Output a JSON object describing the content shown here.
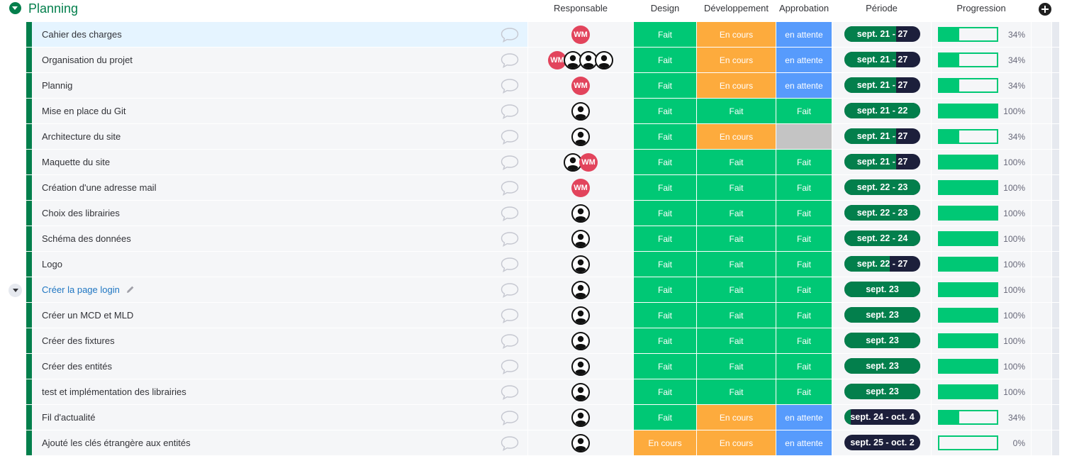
{
  "group": {
    "title": "Planning",
    "color": "#037f4c"
  },
  "columns": {
    "owner": "Responsable",
    "design": "Design",
    "dev": "Développement",
    "approval": "Approbation",
    "period": "Période",
    "progress": "Progression"
  },
  "colors": {
    "done": "#00c875",
    "working": "#fdab3d",
    "waiting": "#579bfc",
    "empty": "#c4c4c4",
    "timeline_fill": "#037f4c",
    "timeline_rest": "#1c1f3b",
    "owner_initials_bg": "#e2445c"
  },
  "icons": {
    "comment": "speech-bubble-icon",
    "person": "user-avatar-icon",
    "expand": "chevron-down-icon",
    "add_column": "plus-circle-icon",
    "edit": "pencil-icon"
  },
  "rows": [
    {
      "name": "Cahier des charges",
      "selected": true,
      "owners": [
        "WM"
      ],
      "design": "Fait",
      "dev": "En cours",
      "approval": "en attente",
      "period": "sept. 21 - 27",
      "period_elapsed": 0.68,
      "progress": 34,
      "progress_label": "34%"
    },
    {
      "name": "Organisation du projet",
      "owners": [
        "WM",
        "person",
        "person",
        "person"
      ],
      "design": "Fait",
      "dev": "En cours",
      "approval": "en attente",
      "period": "sept. 21 - 27",
      "period_elapsed": 0.68,
      "progress": 34,
      "progress_label": "34%"
    },
    {
      "name": "Plannig",
      "owners": [
        "WM"
      ],
      "design": "Fait",
      "dev": "En cours",
      "approval": "en attente",
      "period": "sept. 21 - 27",
      "period_elapsed": 0.68,
      "progress": 34,
      "progress_label": "34%"
    },
    {
      "name": "Mise en place du Git",
      "owners": [
        "person"
      ],
      "design": "Fait",
      "dev": "Fait",
      "approval": "Fait",
      "period": "sept. 21 - 22",
      "period_elapsed": 1.0,
      "progress": 100,
      "progress_label": "100%"
    },
    {
      "name": "Architecture du site",
      "owners": [
        "person"
      ],
      "design": "Fait",
      "dev": "En cours",
      "approval": "",
      "period": "sept. 21 - 27",
      "period_elapsed": 0.68,
      "progress": 34,
      "progress_label": "34%"
    },
    {
      "name": "Maquette du site",
      "owners": [
        "person",
        "WM"
      ],
      "design": "Fait",
      "dev": "Fait",
      "approval": "Fait",
      "period": "sept. 21 - 27",
      "period_elapsed": 0.68,
      "progress": 100,
      "progress_label": "100%"
    },
    {
      "name": "Création d'une adresse mail",
      "owners": [
        "WM"
      ],
      "design": "Fait",
      "dev": "Fait",
      "approval": "Fait",
      "period": "sept. 22 - 23",
      "period_elapsed": 1.0,
      "progress": 100,
      "progress_label": "100%"
    },
    {
      "name": "Choix des librairies",
      "owners": [
        "person"
      ],
      "design": "Fait",
      "dev": "Fait",
      "approval": "Fait",
      "period": "sept. 22 - 23",
      "period_elapsed": 1.0,
      "progress": 100,
      "progress_label": "100%"
    },
    {
      "name": "Schéma des données",
      "owners": [
        "person"
      ],
      "design": "Fait",
      "dev": "Fait",
      "approval": "Fait",
      "period": "sept. 22 - 24",
      "period_elapsed": 1.0,
      "progress": 100,
      "progress_label": "100%"
    },
    {
      "name": "Logo",
      "owners": [
        "person"
      ],
      "design": "Fait",
      "dev": "Fait",
      "approval": "Fait",
      "period": "sept. 22 - 27",
      "period_elapsed": 0.6,
      "progress": 100,
      "progress_label": "100%"
    },
    {
      "name": "Créer la page login",
      "linked": true,
      "expandable": true,
      "owners": [
        "person"
      ],
      "design": "Fait",
      "dev": "Fait",
      "approval": "Fait",
      "period": "sept. 23",
      "period_elapsed": 1.0,
      "progress": 100,
      "progress_label": "100%"
    },
    {
      "name": "Créer un MCD et MLD",
      "owners": [
        "person"
      ],
      "design": "Fait",
      "dev": "Fait",
      "approval": "Fait",
      "period": "sept. 23",
      "period_elapsed": 1.0,
      "progress": 100,
      "progress_label": "100%"
    },
    {
      "name": "Créer des fixtures",
      "owners": [
        "person"
      ],
      "design": "Fait",
      "dev": "Fait",
      "approval": "Fait",
      "period": "sept. 23",
      "period_elapsed": 1.0,
      "progress": 100,
      "progress_label": "100%"
    },
    {
      "name": "Créer des entités",
      "owners": [
        "person"
      ],
      "design": "Fait",
      "dev": "Fait",
      "approval": "Fait",
      "period": "sept. 23",
      "period_elapsed": 1.0,
      "progress": 100,
      "progress_label": "100%"
    },
    {
      "name": "test et implémentation des librairies",
      "owners": [
        "person"
      ],
      "design": "Fait",
      "dev": "Fait",
      "approval": "Fait",
      "period": "sept. 23",
      "period_elapsed": 1.0,
      "progress": 100,
      "progress_label": "100%"
    },
    {
      "name": "Fil d'actualité",
      "owners": [
        "person"
      ],
      "design": "Fait",
      "dev": "En cours",
      "approval": "en attente",
      "period": "sept. 24 - oct. 4",
      "period_elapsed": 0.08,
      "progress": 34,
      "progress_label": "34%"
    },
    {
      "name": "Ajouté les clés étrangère aux entités",
      "owners": [
        "person"
      ],
      "design": "En cours",
      "dev": "En cours",
      "approval": "en attente",
      "period": "sept. 25 - oct. 2",
      "period_elapsed": 0.0,
      "progress": 0,
      "progress_label": "0%"
    }
  ]
}
